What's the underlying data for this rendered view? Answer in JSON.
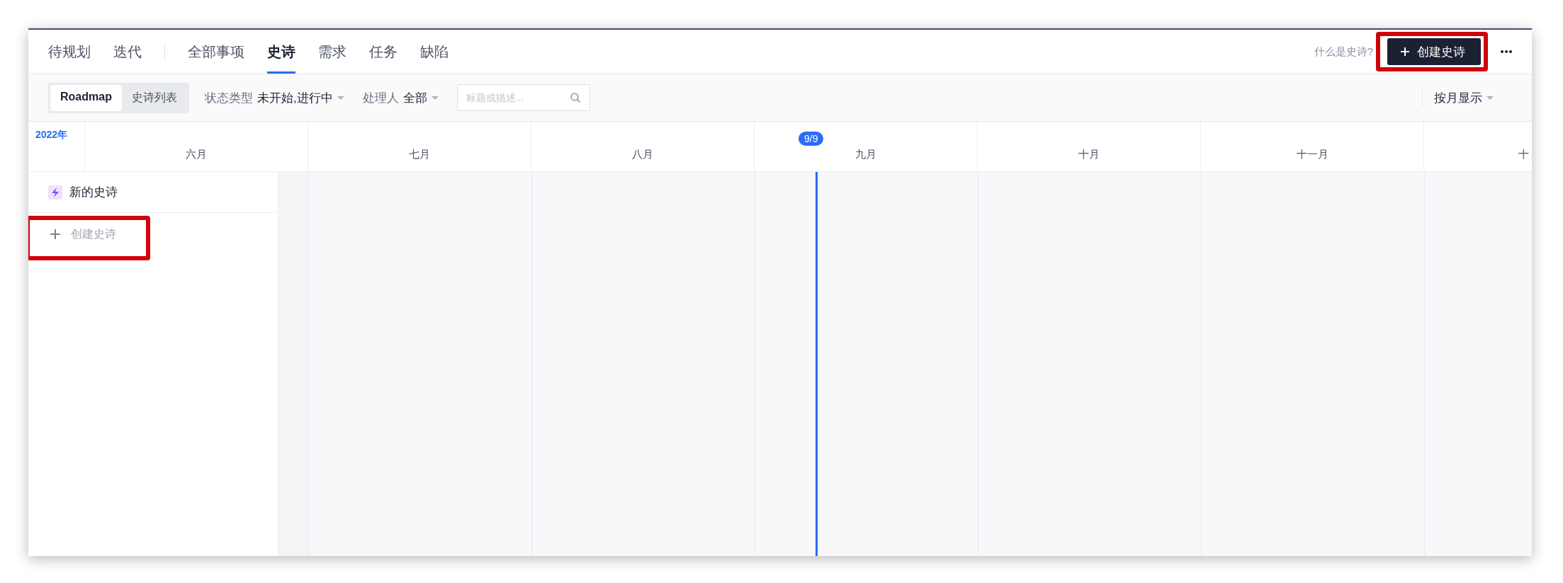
{
  "nav": {
    "tab_groups": [
      [
        {
          "label": "待规划",
          "selected": false
        },
        {
          "label": "迭代",
          "selected": false
        }
      ],
      [
        {
          "label": "全部事项",
          "selected": false
        },
        {
          "label": "史诗",
          "selected": true
        },
        {
          "label": "需求",
          "selected": false
        },
        {
          "label": "任务",
          "selected": false
        },
        {
          "label": "缺陷",
          "selected": false
        }
      ]
    ],
    "help_link": "什么是史诗?",
    "create_button": {
      "label": "创建史诗",
      "highlighted": true
    }
  },
  "toolbar": {
    "view_switch": [
      {
        "label": "Roadmap",
        "selected": true
      },
      {
        "label": "史诗列表",
        "selected": false
      }
    ],
    "filters": [
      {
        "label": "状态类型",
        "value": "未开始,进行中"
      },
      {
        "label": "处理人",
        "value": "全部"
      }
    ],
    "search": {
      "placeholder": "标题或描述..."
    },
    "display_mode": "按月显示"
  },
  "timeline": {
    "year": "2022年",
    "months": [
      {
        "label": "六月"
      },
      {
        "label": "七月"
      },
      {
        "label": "八月"
      },
      {
        "label": "九月",
        "today_marker": "9/9"
      },
      {
        "label": "十月"
      },
      {
        "label": "十一月"
      },
      {
        "label": "十"
      }
    ]
  },
  "epics": [
    {
      "title": "新的史诗"
    }
  ],
  "create_row": {
    "label": "创建史诗",
    "highlighted": true
  }
}
